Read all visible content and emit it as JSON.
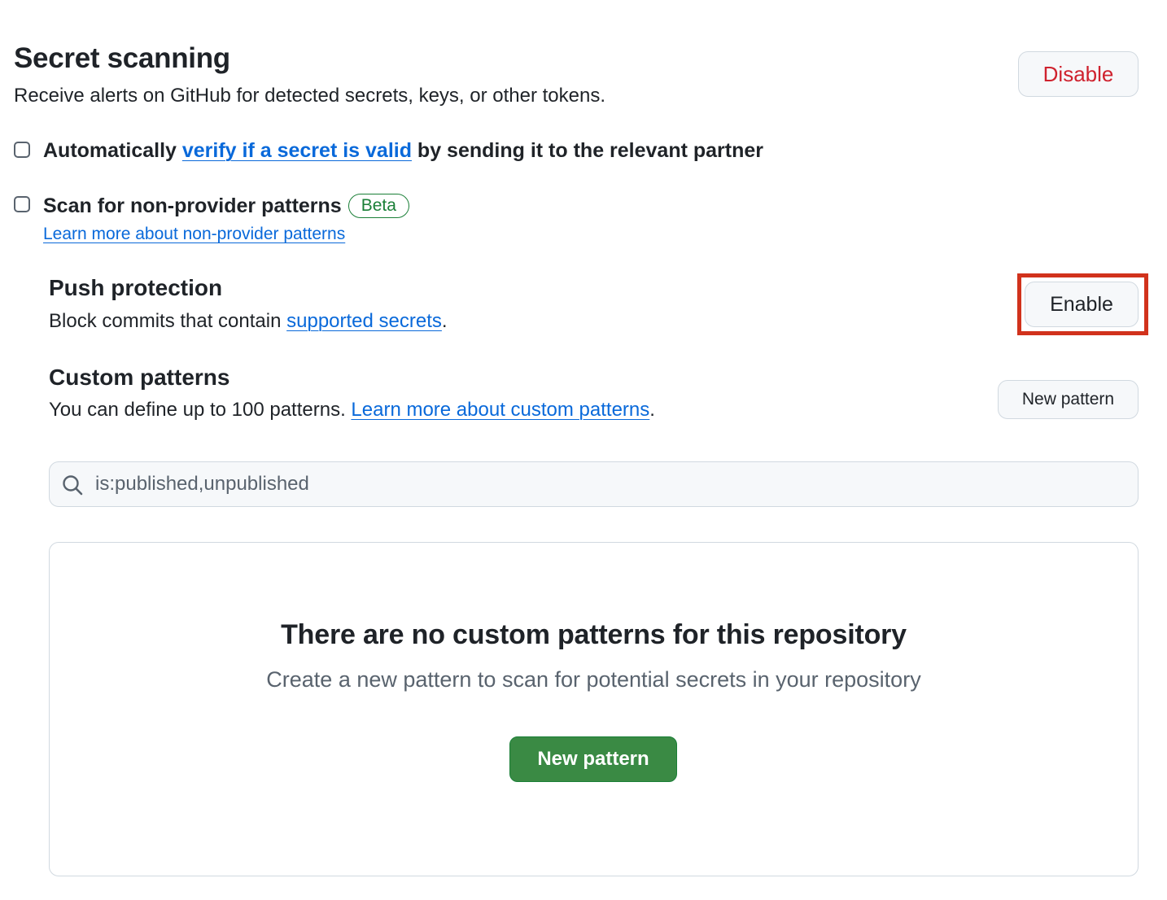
{
  "secret_scanning": {
    "title": "Secret scanning",
    "subtitle": "Receive alerts on GitHub for detected secrets, keys, or other tokens.",
    "disable_label": "Disable"
  },
  "options": {
    "verify": {
      "checked": false,
      "prefix": "Automatically ",
      "link": "verify if a secret is valid",
      "suffix": " by sending it to the relevant partner"
    },
    "non_provider": {
      "checked": false,
      "label": "Scan for non-provider patterns",
      "badge": "Beta",
      "learn_more": "Learn more about non-provider patterns"
    }
  },
  "push_protection": {
    "title": "Push protection",
    "desc_prefix": "Block commits that contain ",
    "desc_link": "supported secrets",
    "desc_suffix": ".",
    "enable_label": "Enable"
  },
  "custom_patterns": {
    "title": "Custom patterns",
    "desc_prefix": "You can define up to 100 patterns. ",
    "desc_link": "Learn more about custom patterns",
    "desc_suffix": ".",
    "new_pattern_label": "New pattern",
    "search_value": "is:published,unpublished",
    "empty_title": "There are no custom patterns for this repository",
    "empty_desc": "Create a new pattern to scan for potential secrets in your repository",
    "empty_button": "New pattern"
  },
  "colors": {
    "link": "#0969da",
    "danger": "#cf222e",
    "success": "#1f883d",
    "highlight": "#d1321c"
  }
}
